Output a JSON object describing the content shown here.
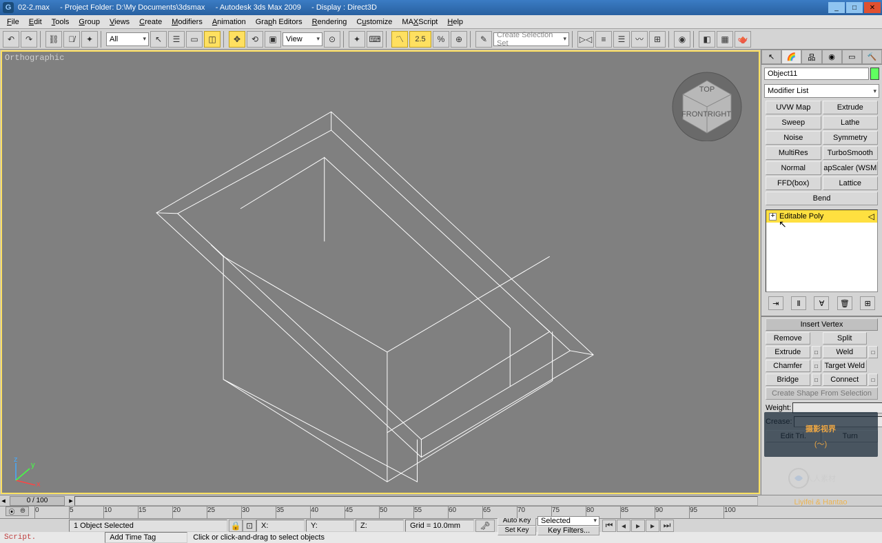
{
  "title": {
    "file": "02-2.max",
    "project": "- Project Folder: D:\\My Documents\\3dsmax",
    "app": "- Autodesk 3ds Max  2009",
    "display": "- Display : Direct3D"
  },
  "menu": [
    "File",
    "Edit",
    "Tools",
    "Group",
    "Views",
    "Create",
    "Modifiers",
    "Animation",
    "Graph Editors",
    "Rendering",
    "Customize",
    "MAXScript",
    "Help"
  ],
  "toolbar": {
    "filter": "All",
    "view_mode": "View",
    "snap_angle": "2.5",
    "sel_set_placeholder": "Create Selection Set"
  },
  "viewport": {
    "label": "Orthographic"
  },
  "viewcube": {
    "top": "TOP",
    "front": "FRONT",
    "right": "RIGHT"
  },
  "panel": {
    "object_name": "Object11",
    "modifier_list_label": "Modifier List",
    "modifiers": [
      [
        "UVW Map",
        "Extrude"
      ],
      [
        "Sweep",
        "Lathe"
      ],
      [
        "Noise",
        "Symmetry"
      ],
      [
        "MultiRes",
        "TurboSmooth"
      ],
      [
        "Normal",
        "apScaler (WSM"
      ],
      [
        "FFD(box)",
        "Lattice"
      ]
    ],
    "modifier_full": "Bend",
    "stack_item": "Editable Poly",
    "rollout_insert": "Insert Vertex",
    "edit_buttons": [
      [
        "Remove",
        "Split"
      ],
      [
        "Extrude",
        "Weld"
      ],
      [
        "Chamfer",
        "Target Weld"
      ],
      [
        "Bridge",
        "Connect"
      ]
    ],
    "create_shape": "Create Shape From Selection",
    "weight_label": "Weight:",
    "crease_label": "Crease:",
    "edit_tri": "Edit Tri.",
    "turn": "Turn"
  },
  "timeline": {
    "slider": "0 / 100",
    "ticks": [
      "0",
      "5",
      "10",
      "15",
      "20",
      "25",
      "30",
      "35",
      "40",
      "45",
      "50",
      "55",
      "60",
      "65",
      "70",
      "75",
      "80",
      "85",
      "90",
      "95",
      "100"
    ]
  },
  "status": {
    "selected": "1 Object Selected",
    "x": "X:",
    "y": "Y:",
    "z": "Z:",
    "grid": "Grid = 10.0mm",
    "autokey": "Auto Key",
    "setkey": "Set Key",
    "selected_mode": "Selected",
    "keyfilters": "Key Filters...",
    "add_time_tag": "Add Time Tag",
    "prompt": "Click or click-and-drag to select objects"
  },
  "script_label": "Script.",
  "watermark": {
    "line1": "摄影视界",
    "line2": "Liyifei & Hantao",
    "mid": "人人素材"
  }
}
